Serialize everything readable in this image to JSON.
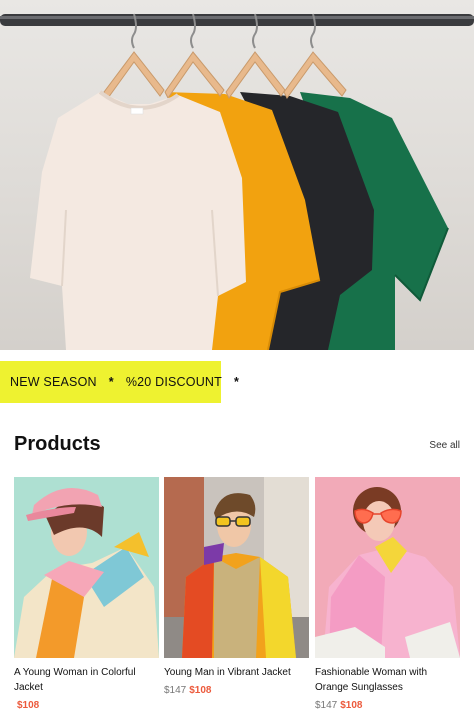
{
  "hero": {
    "image": "t-shirts-on-hangers"
  },
  "promo": {
    "text_1": "NEW SEASON",
    "separator_1": "*",
    "text_2": "%20 DISCOUNT",
    "separator_2": "*"
  },
  "products_section": {
    "title": "Products",
    "see_all": "See all",
    "items": [
      {
        "name": "A Young Woman in Colorful Jacket",
        "old_price": "",
        "price": "$108"
      },
      {
        "name": "Young Man in Vibrant Jacket",
        "old_price": "$147",
        "price": "$108"
      },
      {
        "name": "Fashionable Woman with Orange Sunglasses",
        "old_price": "$147",
        "price": "$108"
      }
    ]
  },
  "colors": {
    "promo_bg": "#eef230",
    "price": "#ec5a3c",
    "old_price": "#777777"
  }
}
